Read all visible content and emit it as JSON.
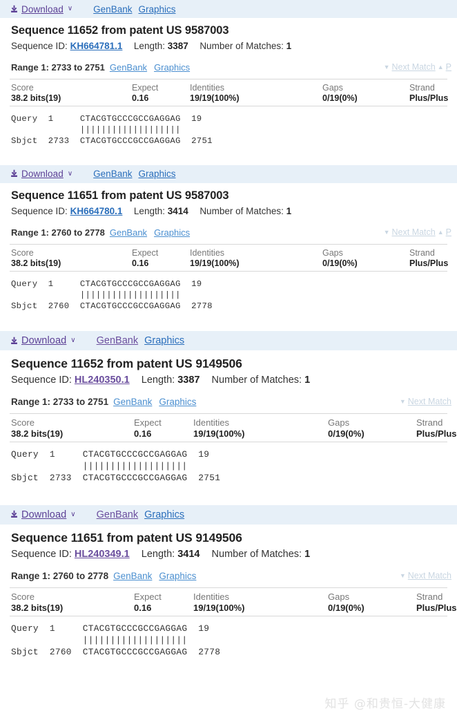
{
  "blocks": [
    {
      "header": {
        "download_label": "Download",
        "download_caret": "∨",
        "genbank": "GenBank",
        "graphics": "Graphics",
        "genbank_visited": false,
        "graphics_visited": false
      },
      "title": "Sequence 11652 from patent US 9587003",
      "meta": {
        "id_label": "Sequence ID:",
        "id_value": "KH664781.1",
        "id_visited": false,
        "length_label": "Length:",
        "length_value": "3387",
        "matches_label": "Number of Matches:",
        "matches_value": "1"
      },
      "range": {
        "label": "Range 1: 2733 to 2751",
        "genbank": "GenBank",
        "graphics": "Graphics",
        "next_match": "Next Match",
        "prev_match": "P",
        "show_prev": true,
        "down_arrow": "▼",
        "up_arrow": "▲"
      },
      "stats": {
        "headers": [
          "Score",
          "Expect",
          "Identities",
          "Gaps",
          "Strand"
        ],
        "values": [
          "38.2 bits(19)",
          "0.16",
          "19/19(100%)",
          "0/19(0%)",
          "Plus/Plus"
        ]
      },
      "alignment": {
        "query_label": "Query",
        "query_start": "1",
        "query_seq": "CTACGTGCCCGCCGAGGAG",
        "query_end": "19",
        "midline": "|||||||||||||||||||",
        "sbjct_label": "Sbjct",
        "sbjct_start": "2733",
        "sbjct_seq": "CTACGTGCCCGCCGAGGAG",
        "sbjct_end": "2751",
        "text": "Query  1     CTACGTGCCCGCCGAGGAG  19\n             |||||||||||||||||||\nSbjct  2733  CTACGTGCCCGCCGAGGAG  2751"
      }
    },
    {
      "header": {
        "download_label": "Download",
        "download_caret": "∨",
        "genbank": "GenBank",
        "graphics": "Graphics",
        "genbank_visited": false,
        "graphics_visited": false
      },
      "title": "Sequence 11651 from patent US 9587003",
      "meta": {
        "id_label": "Sequence ID:",
        "id_value": "KH664780.1",
        "id_visited": false,
        "length_label": "Length:",
        "length_value": "3414",
        "matches_label": "Number of Matches:",
        "matches_value": "1"
      },
      "range": {
        "label": "Range 1: 2760 to 2778",
        "genbank": "GenBank",
        "graphics": "Graphics",
        "next_match": "Next Match",
        "prev_match": "P",
        "show_prev": true,
        "down_arrow": "▼",
        "up_arrow": "▲"
      },
      "stats": {
        "headers": [
          "Score",
          "Expect",
          "Identities",
          "Gaps",
          "Strand"
        ],
        "values": [
          "38.2 bits(19)",
          "0.16",
          "19/19(100%)",
          "0/19(0%)",
          "Plus/Plus"
        ]
      },
      "alignment": {
        "query_label": "Query",
        "query_start": "1",
        "query_seq": "CTACGTGCCCGCCGAGGAG",
        "query_end": "19",
        "midline": "|||||||||||||||||||",
        "sbjct_label": "Sbjct",
        "sbjct_start": "2760",
        "sbjct_seq": "CTACGTGCCCGCCGAGGAG",
        "sbjct_end": "2778",
        "text": "Query  1     CTACGTGCCCGCCGAGGAG  19\n             |||||||||||||||||||\nSbjct  2760  CTACGTGCCCGCCGAGGAG  2778"
      }
    },
    {
      "header": {
        "download_label": "Download",
        "download_caret": "∨",
        "genbank": "GenBank",
        "graphics": "Graphics",
        "genbank_visited": true,
        "graphics_visited": false
      },
      "title": "Sequence 11652 from patent US 9149506",
      "meta": {
        "id_label": "Sequence ID:",
        "id_value": "HL240350.1",
        "id_visited": true,
        "length_label": "Length:",
        "length_value": "3387",
        "matches_label": "Number of Matches:",
        "matches_value": "1"
      },
      "range": {
        "label": "Range 1: 2733 to 2751",
        "genbank": "GenBank",
        "graphics": "Graphics",
        "next_match": "Next Match",
        "prev_match": "",
        "show_prev": false,
        "down_arrow": "▼",
        "up_arrow": "▲"
      },
      "stats": {
        "headers": [
          "Score",
          "Expect",
          "Identities",
          "Gaps",
          "Strand"
        ],
        "values": [
          "38.2 bits(19)",
          "0.16",
          "19/19(100%)",
          "0/19(0%)",
          "Plus/Plus"
        ]
      },
      "alignment": {
        "query_label": "Query",
        "query_start": "1",
        "query_seq": "CTACGTGCCCGCCGAGGAG",
        "query_end": "19",
        "midline": "|||||||||||||||||||",
        "sbjct_label": "Sbjct",
        "sbjct_start": "2733",
        "sbjct_seq": "CTACGTGCCCGCCGAGGAG",
        "sbjct_end": "2751",
        "text": "Query  1     CTACGTGCCCGCCGAGGAG  19\n             |||||||||||||||||||\nSbjct  2733  CTACGTGCCCGCCGAGGAG  2751"
      }
    },
    {
      "header": {
        "download_label": "Download",
        "download_caret": "∨",
        "genbank": "GenBank",
        "graphics": "Graphics",
        "genbank_visited": true,
        "graphics_visited": false
      },
      "title": "Sequence 11651 from patent US 9149506",
      "meta": {
        "id_label": "Sequence ID:",
        "id_value": "HL240349.1",
        "id_visited": true,
        "length_label": "Length:",
        "length_value": "3414",
        "matches_label": "Number of Matches:",
        "matches_value": "1"
      },
      "range": {
        "label": "Range 1: 2760 to 2778",
        "genbank": "GenBank",
        "graphics": "Graphics",
        "next_match": "Next Match",
        "prev_match": "",
        "show_prev": false,
        "down_arrow": "▼",
        "up_arrow": "▲"
      },
      "stats": {
        "headers": [
          "Score",
          "Expect",
          "Identities",
          "Gaps",
          "Strand"
        ],
        "values": [
          "38.2 bits(19)",
          "0.16",
          "19/19(100%)",
          "0/19(0%)",
          "Plus/Plus"
        ]
      },
      "alignment": {
        "query_label": "Query",
        "query_start": "1",
        "query_seq": "CTACGTGCCCGCCGAGGAG",
        "query_end": "19",
        "midline": "|||||||||||||||||||",
        "sbjct_label": "Sbjct",
        "sbjct_start": "2760",
        "sbjct_seq": "CTACGTGCCCGCCGAGGAG",
        "sbjct_end": "2778",
        "text": "Query  1     CTACGTGCCCGCCGAGGAG  19\n             |||||||||||||||||||\nSbjct  2760  CTACGTGCCCGCCGAGGAG  2778"
      }
    }
  ],
  "watermark": "知乎 @和贵恒-大健康",
  "icons": {
    "download": "download-icon",
    "caret_down": "chevron-down-icon"
  },
  "colors": {
    "header_bg": "#e7f0f8",
    "link_blue": "#2a6ebb",
    "link_visited": "#6b4f9e",
    "range_link": "#4b8fd0",
    "muted": "#c9d6e2"
  }
}
